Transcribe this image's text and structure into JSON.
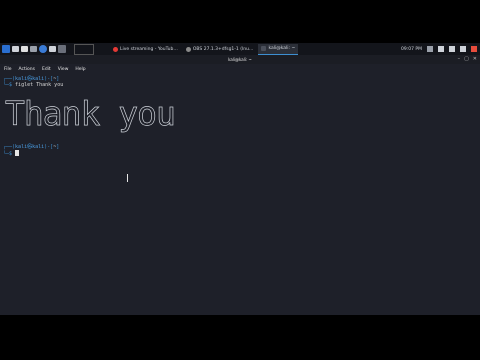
{
  "panel": {
    "tasks": [
      {
        "label": "Live streaming - YouTub…",
        "color": "#e53935"
      },
      {
        "label": "OBS 27.1.3+dfsg1-1 (lnu…",
        "color": "#8a8a8a"
      },
      {
        "label": "kali@kali: ~",
        "color": "#4a4f5a"
      }
    ],
    "clock": "09:07 PM"
  },
  "window": {
    "title": "kali@kali: ~"
  },
  "menu": [
    "File",
    "Actions",
    "Edit",
    "View",
    "Help"
  ],
  "terminal": {
    "prompt_user": "kali",
    "prompt_host": "kali",
    "prompt_dir": "~",
    "command": "figlet Thank you",
    "figlet_text": "Thank you"
  }
}
